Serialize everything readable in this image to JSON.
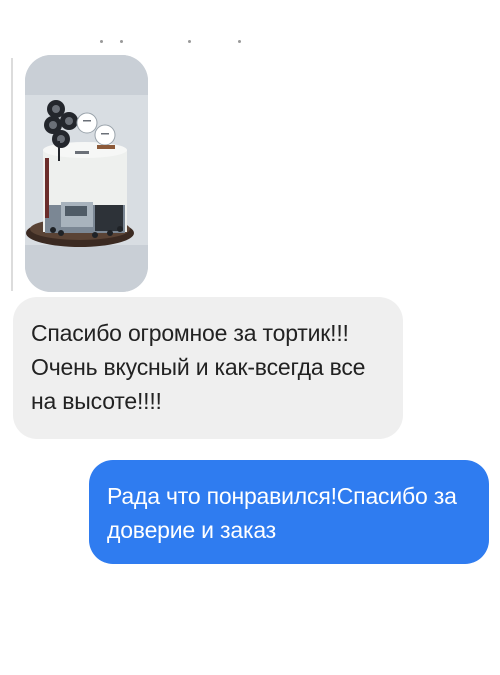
{
  "conversation": {
    "incoming_photo": {
      "icon": "cake-photo",
      "description_colors": {
        "background": "#c9cfd6",
        "cake": "#eef0ee",
        "tiers": "#2a2d33"
      }
    },
    "incoming_message": {
      "lines": [
        "Спасибо огромное за тортик!!!",
        "Очень вкусный и как-всегда все",
        "на высоте!!!!"
      ]
    },
    "outgoing_message": {
      "lines": [
        "Рада что понравился!Спасибо за",
        "доверие и заказ"
      ]
    }
  },
  "colors": {
    "incoming_bubble": "#efefef",
    "outgoing_bubble": "#2f7cf0",
    "outgoing_text": "#ffffff",
    "incoming_text": "#222222"
  }
}
